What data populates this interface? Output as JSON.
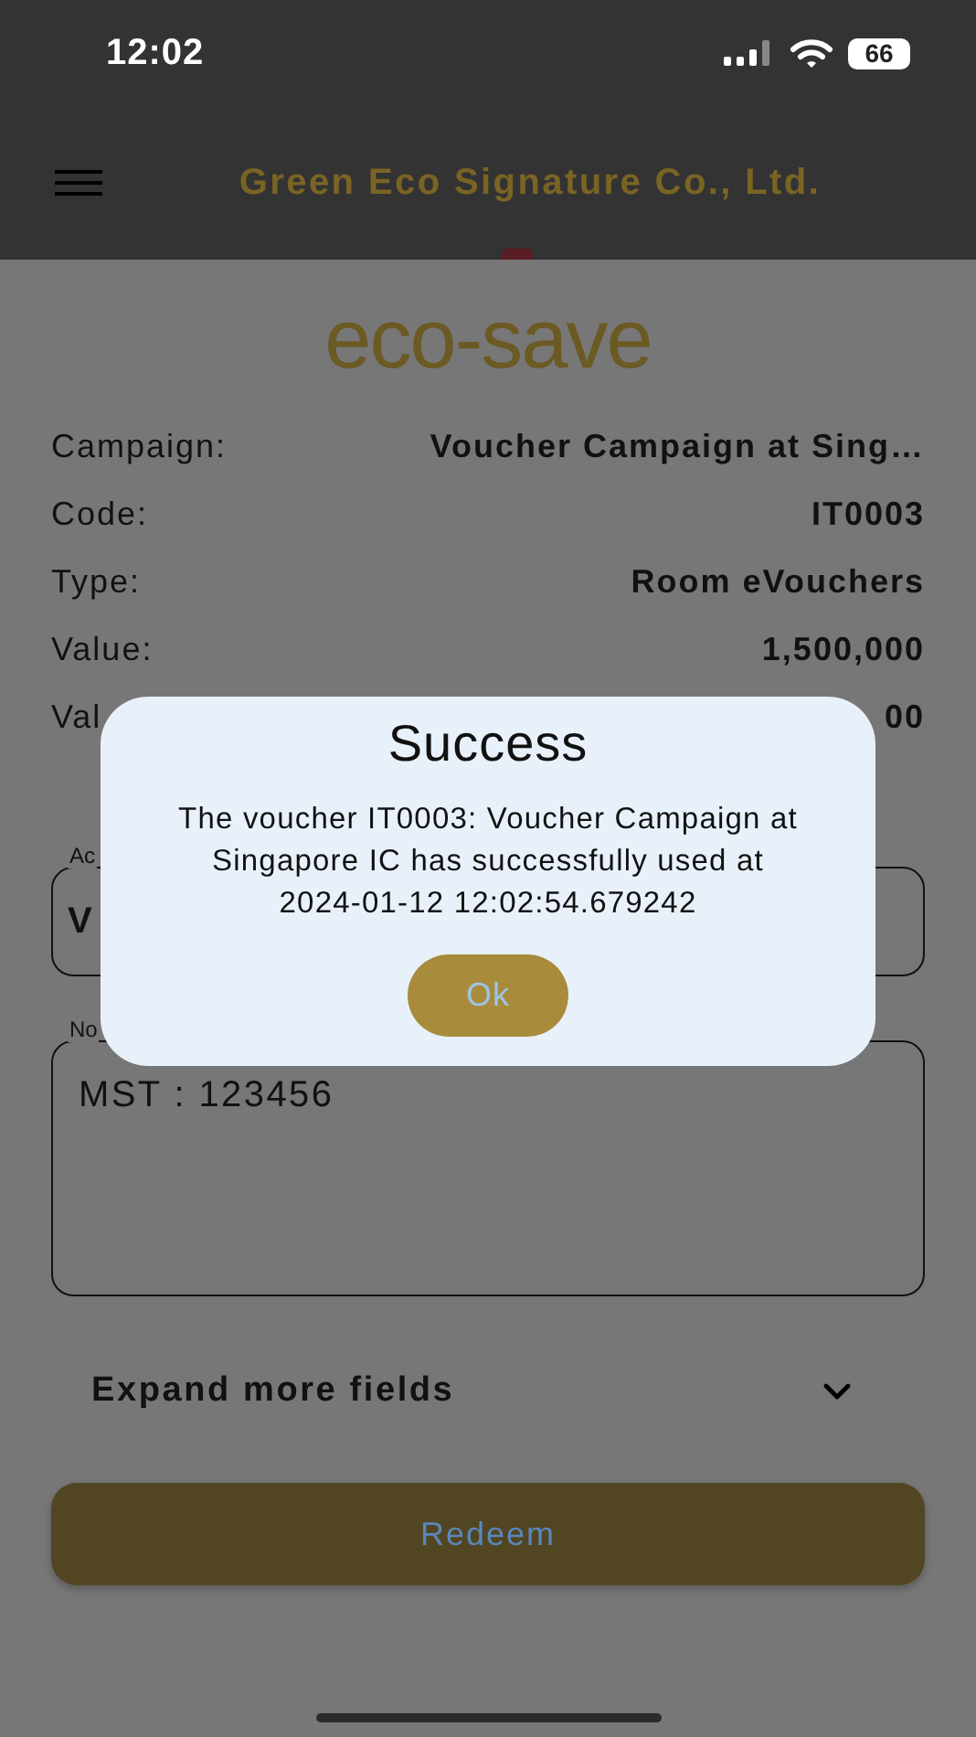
{
  "status_bar": {
    "time": "12:02",
    "battery": "66"
  },
  "header": {
    "title": "Green Eco Signature Co., Ltd."
  },
  "logo": {
    "text": "eco-save"
  },
  "details": [
    {
      "label": "Campaign:",
      "value": "Voucher Campaign at Sing…"
    },
    {
      "label": "Code:",
      "value": "IT0003"
    },
    {
      "label": "Type:",
      "value": "Room eVouchers"
    },
    {
      "label": "Value:",
      "value": "1,500,000"
    },
    {
      "label": "Val",
      "value": "00"
    }
  ],
  "fields": [
    {
      "kind": "single",
      "label": "Ac",
      "value": "V"
    },
    {
      "kind": "multiline",
      "label": "No",
      "value": "MST : 123456"
    }
  ],
  "expand": {
    "label": "Expand more fields",
    "expanded": false
  },
  "redeem_button": {
    "label": "Redeem"
  },
  "dialog": {
    "title": "Success",
    "message": "The voucher IT0003: Voucher Campaign at Singapore IC has successfully used at 2024-01-12 12:02:54.679242",
    "button": "Ok"
  }
}
